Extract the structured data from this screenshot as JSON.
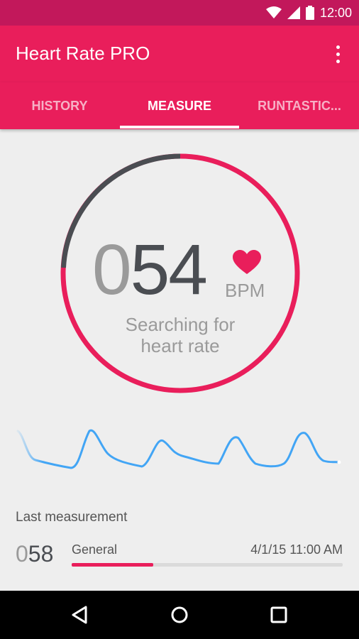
{
  "status_bar": {
    "time": "12:00"
  },
  "app_bar": {
    "title": "Heart Rate PRO"
  },
  "tabs": [
    {
      "label": "HISTORY",
      "active": false
    },
    {
      "label": "MEASURE",
      "active": true
    },
    {
      "label": "RUNTASTIC...",
      "active": false
    }
  ],
  "measure": {
    "bpm_leading_zero": "0",
    "bpm_value": "54",
    "unit": "BPM",
    "status_line1": "Searching for",
    "status_line2": "heart rate"
  },
  "last_measurement": {
    "title": "Last measurement",
    "value_leading_zero": "0",
    "value": "58",
    "label": "General",
    "datetime": "4/1/15 11:00 AM",
    "progress_fraction": 0.3
  },
  "colors": {
    "accent": "#e91e5b",
    "status_bar": "#c2185b",
    "dark_gray": "#4a4d52",
    "wave": "#42a5f5"
  }
}
